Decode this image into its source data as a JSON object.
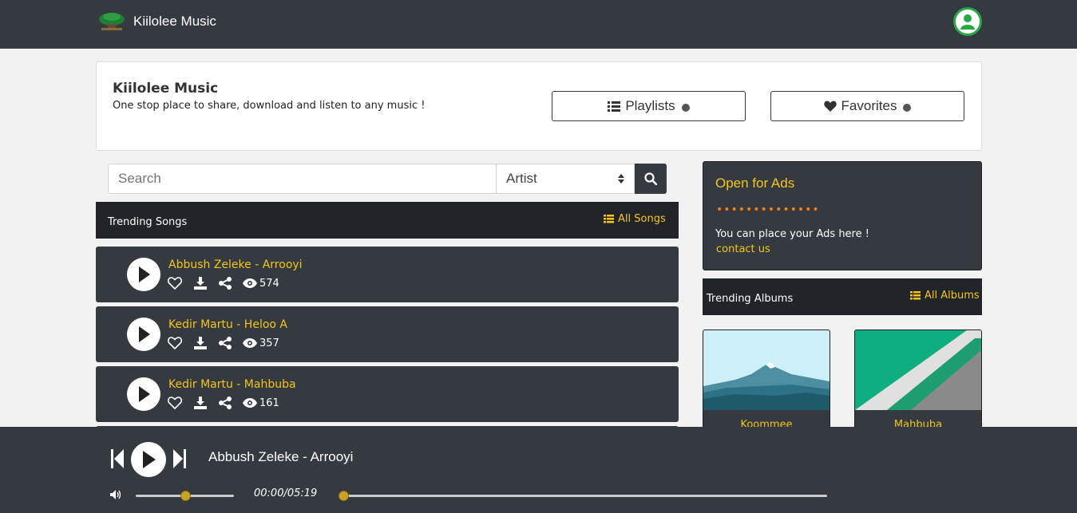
{
  "navbar": {
    "brand": "Kiilolee Music",
    "logo_icon": "tree-logo-icon",
    "user_icon": "user-icon"
  },
  "hero": {
    "title": "Kiilolee Music",
    "subtitle": "One stop place to share, download and listen to any music !",
    "playlists_label": "Playlists",
    "favorites_label": "Favorites"
  },
  "search": {
    "placeholder": "Search",
    "filter_selected": "Artist"
  },
  "trending_songs": {
    "title": "Trending Songs",
    "all_label": "All Songs",
    "songs": [
      {
        "title": "Abbush Zeleke - Arrooyi",
        "views": "574"
      },
      {
        "title": "Kedir Martu - Heloo A",
        "views": "357"
      },
      {
        "title": "Kedir Martu - Mahbuba",
        "views": "161"
      }
    ]
  },
  "ads": {
    "title": "Open for Ads",
    "dots": "••••••••••••••",
    "text": "You can place your Ads here !",
    "link": "contact us"
  },
  "trending_albums": {
    "title": "Trending Albums",
    "all_label": "All Albums",
    "albums": [
      {
        "title": "Koommee"
      },
      {
        "title": "Mahbuba"
      }
    ]
  },
  "player": {
    "now_playing": "Abbush Zeleke - Arrooyi",
    "time": "00:00/05:19",
    "volume_fraction": 0.5,
    "progress_fraction": 0.0
  },
  "colors": {
    "navbar": "#343a40",
    "accent": "#f5c518",
    "dark": "#212529",
    "user_ring": "#28a745"
  }
}
